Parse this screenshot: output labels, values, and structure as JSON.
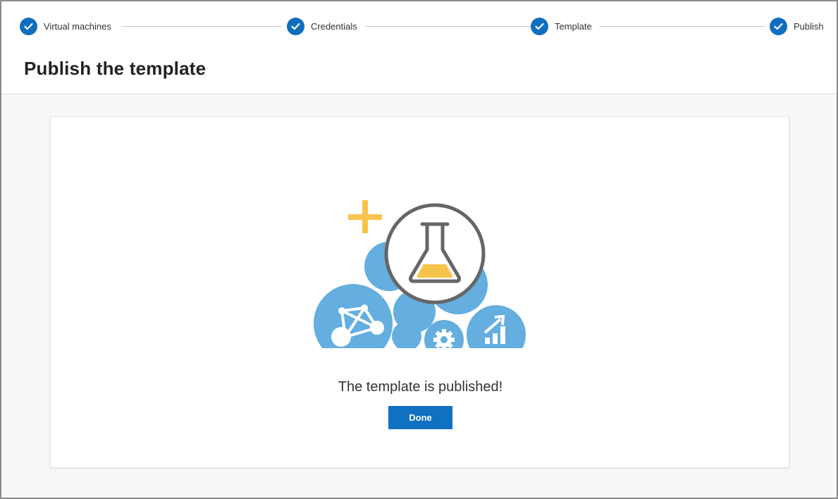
{
  "stepper": {
    "steps": [
      {
        "label": "Virtual machines",
        "status": "complete"
      },
      {
        "label": "Credentials",
        "status": "complete"
      },
      {
        "label": "Template",
        "status": "complete"
      },
      {
        "label": "Publish",
        "status": "complete"
      }
    ]
  },
  "page": {
    "title": "Publish the template"
  },
  "result": {
    "message": "The template is published!",
    "done_label": "Done"
  },
  "colors": {
    "accent": "#1070c2",
    "bubble": "#64aee0",
    "plus": "#f7c44b",
    "flask_fill": "#f7c44b",
    "flask_stroke": "#666666"
  },
  "icons": {
    "step": "checkmark-icon",
    "illustration": [
      "plus-icon",
      "flask-icon",
      "network-icon",
      "gear-icon",
      "chart-up-icon"
    ]
  }
}
